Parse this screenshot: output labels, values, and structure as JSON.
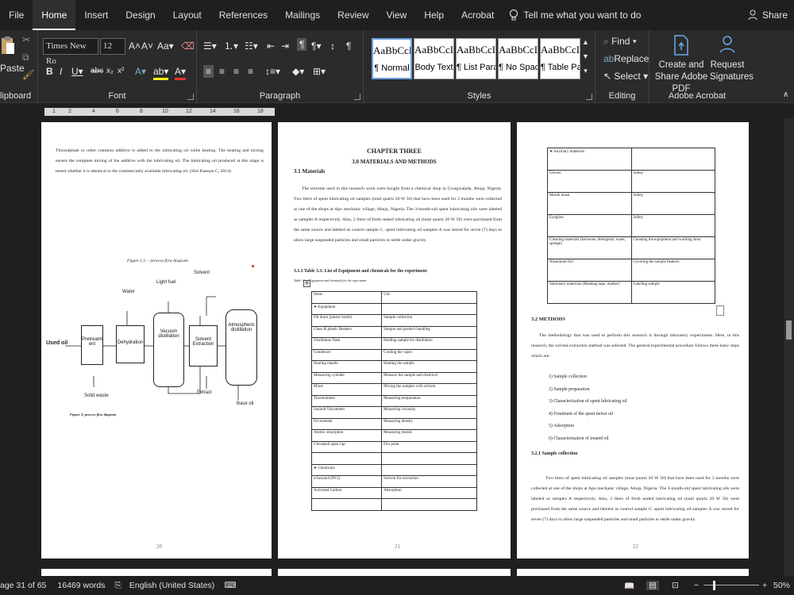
{
  "tabs": [
    "File",
    "Home",
    "Insert",
    "Design",
    "Layout",
    "References",
    "Mailings",
    "Review",
    "View",
    "Help",
    "Acrobat"
  ],
  "active_tab": "Home",
  "tell_me": "Tell me what you want to do",
  "share": "Share",
  "clipboard": {
    "paste": "Paste",
    "label": "lipboard"
  },
  "font": {
    "name": "Times New Ro",
    "size": "12",
    "label": "Font"
  },
  "paragraph": {
    "label": "Paragraph"
  },
  "styles": {
    "label": "Styles",
    "items": [
      {
        "sample": "AaBbCcI",
        "name": "¶ Normal"
      },
      {
        "sample": "AaBbCcI",
        "name": "Body Text"
      },
      {
        "sample": "AaBbCcI",
        "name": "¶ List Para..."
      },
      {
        "sample": "AaBbCcI",
        "name": "¶ No Spac..."
      },
      {
        "sample": "AaBbCcI",
        "name": "¶ Table Pa..."
      }
    ]
  },
  "editing": {
    "find": "Find",
    "replace": "Replace",
    "select": "Select",
    "label": "Editing"
  },
  "acrobat": {
    "create": "Create and Share Adobe PDF",
    "request": "Request Signatures",
    "label": "Adobe Acrobat"
  },
  "ruler": {
    "ticks": [
      "1",
      "2",
      "4",
      "6",
      "8",
      "10",
      "12",
      "14",
      "16",
      "18"
    ]
  },
  "page20": {
    "para": "Thiosulphate or other common additive is added to the lubricating oil while heating. The heating and mixing ensure the complete mixing of the additive with the lubricating oil. The lubricating oil produced at this stage is tested whether it is identical to the commercially available lubricating oil. (Shri Kannan C, 2014)",
    "fig_caption": "Figure 2.1: - process flow diagram",
    "fig_caption2": "Figure 3: process flow diagram",
    "labels": {
      "used_oil": "Used oil",
      "water": "Water",
      "light_fuel": "Light fuel",
      "solvent": "Solvent",
      "pretreatment": "Pretreatm ent",
      "dehydration": "Dehydration",
      "vacuum": "Vacuum distillation",
      "solvent_ext": "Solvent Extraction",
      "atmos": "Atmospheric distillation",
      "solid_waste": "Solid waste",
      "extract": "Extract",
      "base_oil": "Base oil"
    },
    "number": "20"
  },
  "page21": {
    "chapter": "CHAPTER THREE",
    "heading": "3.0   MATERIALS AND METHODS",
    "sub": "3.1 Materials",
    "para": "The solvents used in this research work were bought from a chemical shop in Gwagwalada, Abuja, Nigeria. Two liters of spent lubricating oil samples (total quartz 20 W 50) that have been used for 3 months were collected at one of the shops at Apo mechanic village, Abuja, Nigeria. The 3-month-old spent lubricating oils were labeled as samples A respectively. Also, 2 liters of fresh sealed lubricating oil (total quartz 20 W 50) were purchased from the same source and labeled as control sample C. spent lubricating oil samples A was stored for seven (7) days to allow large suspended particles and small particles to settle under gravity.",
    "table_title": "3.1.1    Table 3.3: List of Equipment and chemicals for the experiment",
    "table_caption": "Table 3.1 of Equipment and chemicals for the experiment",
    "rows": [
      [
        "Items",
        "Use"
      ],
      [
        "➤  Equipment",
        ""
      ],
      [
        "Oil drum (plastic bottle)",
        "Sample collection"
      ],
      [
        "Glass & plastic Beakers",
        "Sample and product handling"
      ],
      [
        "Distillation flask",
        "Holding sample for distillation"
      ],
      [
        "Condenser",
        "Cooling the vapor"
      ],
      [
        "Heating mantle",
        "Heating the sample"
      ],
      [
        "Measuring cylinder",
        "Measure the sample and chemical"
      ],
      [
        "Mixer",
        "Mixing the samples with solvent"
      ],
      [
        "Thermometer",
        "Measuring temperature"
      ],
      [
        "Saybolt Viscometer",
        "Measuring viscosity"
      ],
      [
        "Pycnometer",
        "Measuring density"
      ],
      [
        "Atomic absorption",
        "Measuring metals"
      ],
      [
        "Cleveland open cup",
        "Fire point"
      ],
      [
        "",
        ""
      ],
      [
        "➤  Chemicals",
        ""
      ],
      [
        "n-hexanol (99.5)",
        "Solvent for extraction"
      ],
      [
        "Activated Carbon",
        "Absorption"
      ],
      [
        "",
        ""
      ]
    ],
    "number": "21"
  },
  "page22": {
    "rows": [
      [
        "➤  Auxiliary materials",
        ""
      ],
      [
        "Gloves",
        "Safety"
      ],
      [
        "Mouth mask",
        "Safety"
      ],
      [
        "Eyeglass",
        "Safety"
      ],
      [
        "Cleaning materials (kerosene, detergents, water, sponge)",
        "Cleaning the equipment and working Area"
      ],
      [
        "Aluminum foil",
        "Covering the sample beakers"
      ],
      [
        "Stationary materials (Masking tape, marker)",
        "Labeling sample"
      ]
    ],
    "methods_heading": "3.2 METHODS",
    "methods_para": "The methodology that was used to perform this research is through laboratory experiments. Here, in this research, the solvent extraction method was selected. The general experimental procedure follows three basic steps which are:",
    "steps": [
      "1)   Sample collection",
      "2)   Sample preparation",
      "3)   Characterization of spent lubricating oil",
      "4)   Treatment of the spent motor oil",
      "5)   Adsorption",
      "6)   Characterization of treated oil"
    ],
    "sample_heading": "3.2.1    Sample collection",
    "sample_para": "Two liters of spent lubricating oil samples (total quartz 20 W 50) that have been used for 3 months were collected at one of the shops at Apo mechanic village, Abuja, Nigeria. The 3-month-old spent lubricating oils were labeled as samples A respectively. Also, 2 liters of fresh sealed lubricating oil (total quartz 20 W 50) were purchased from the same source and labeled as control sample C. spent lubricating oil samples A was stored for seven (7) days to allow large suspended particles and small particles to settle under gravity.",
    "number": "22"
  },
  "status": {
    "page": "age 31 of 65",
    "words": "16469 words",
    "language": "English (United States)",
    "zoom": "50%"
  }
}
